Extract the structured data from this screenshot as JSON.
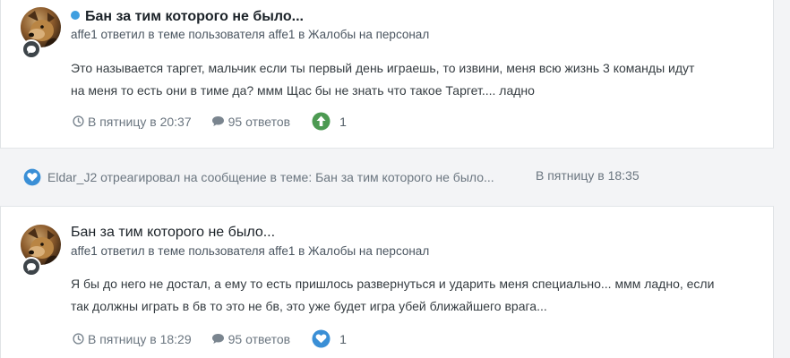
{
  "posts": [
    {
      "title": "Бан за тим которого не было...",
      "unread": true,
      "subtitle": "affe1 ответил в теме пользователя affe1 в Жалобы на персонал",
      "body_lines": [
        "Это называется таргет, мальчик если ты первый день играешь, то извини, меня всю жизнь 3 команды идут",
        "на меня то есть они в тиме да? ммм Щас бы не знать что такое Таргет.... ладно"
      ],
      "time": "В пятницу в 20:37",
      "replies": "95 ответов",
      "reaction_icon": "upvote-icon",
      "reaction_count": "1"
    },
    {
      "title": "Бан за тим которого не было...",
      "unread": false,
      "subtitle": "affe1 ответил в теме пользователя affe1 в Жалобы на персонал",
      "body_lines": [
        "Я бы до него не достал, а ему то есть пришлось развернуться и ударить меня специально... ммм ладно, если",
        "так должны играть в бв то это не бв, это уже будет игра убей ближайшего врага..."
      ],
      "time": "В пятницу в 18:29",
      "replies": "95 ответов",
      "reaction_icon": "heart-icon",
      "reaction_count": "1"
    }
  ],
  "activity": {
    "text": "Eldar_J2 отреагировал на сообщение в теме: Бан за тим которого не было...",
    "time": "В пятницу в 18:35",
    "icon": "heart-icon"
  },
  "colors": {
    "unread_dot": "#3f9fe0",
    "upvote": "#4c9a52",
    "heart": "#3a8fd6",
    "meta_text": "#6b7680"
  }
}
